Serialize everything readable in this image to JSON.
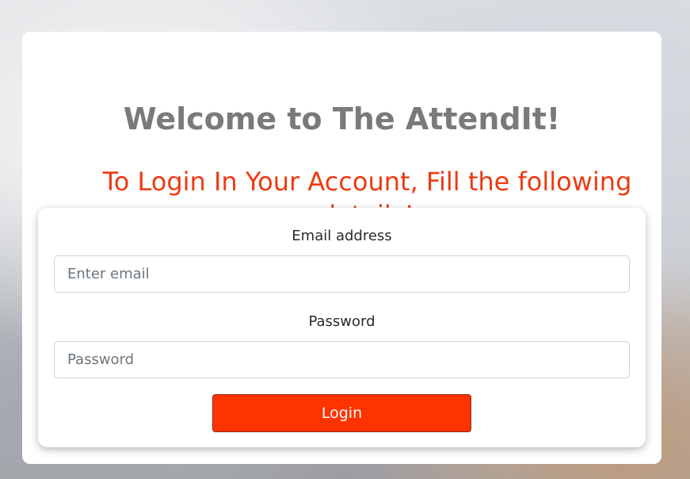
{
  "header": {
    "title": "Welcome to The AttendIt!",
    "subtitle": "To Login In Your Account, Fill the following details!"
  },
  "form": {
    "email_label": "Email address",
    "email_placeholder": "Enter email",
    "email_value": "",
    "password_label": "Password",
    "password_placeholder": "Password",
    "password_value": "",
    "login_label": "Login"
  },
  "colors": {
    "title": "#7a7a7a",
    "subtitle": "#ee3a12",
    "button": "#ff3300"
  }
}
